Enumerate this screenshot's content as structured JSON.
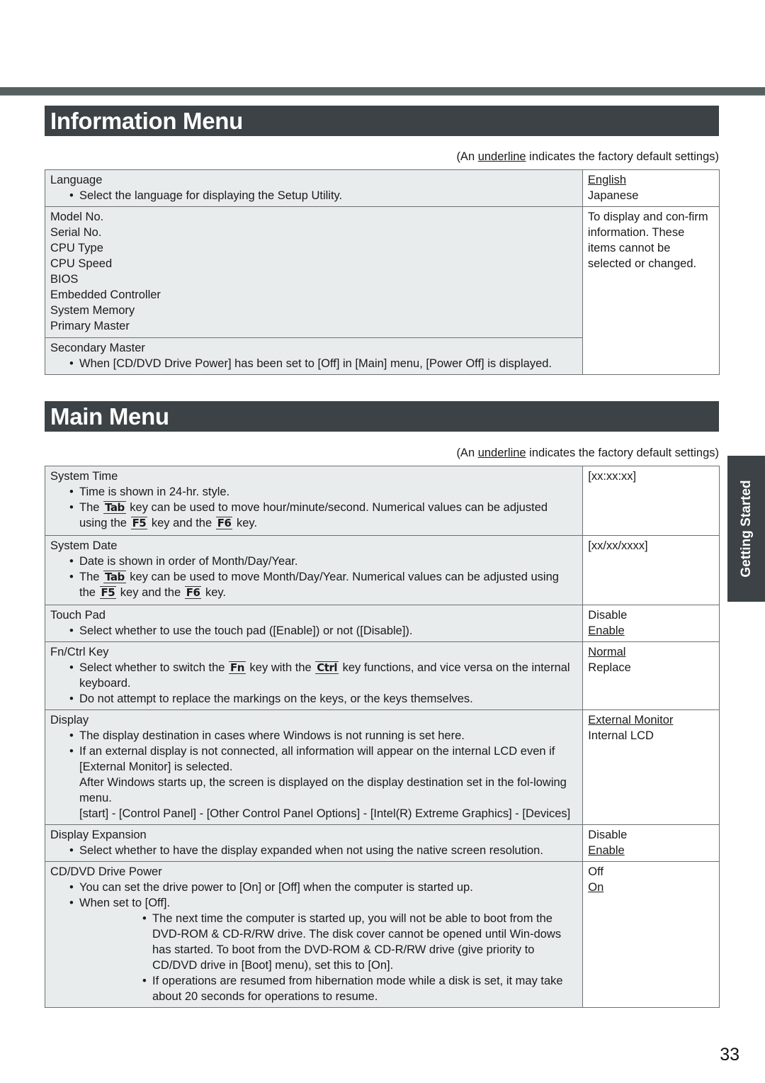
{
  "page": {
    "number": "33",
    "side_tab": "Getting Started"
  },
  "note": {
    "prefix": "(An ",
    "underline_word": "underline",
    "suffix": " indicates the factory default settings)"
  },
  "information_menu": {
    "title": "Information Menu",
    "rows": [
      {
        "label": "Language",
        "bullets": [
          "Select the language for displaying the Setup Utility."
        ],
        "options": [
          {
            "text": "English",
            "default": true
          },
          {
            "text": "Japanese",
            "default": false
          }
        ]
      }
    ],
    "info_items": [
      "Model No.",
      "Serial No.",
      "CPU Type",
      "CPU Speed",
      "BIOS",
      "Embedded Controller",
      "System Memory",
      "Primary Master"
    ],
    "info_note": "To display and con-firm information. These items cannot be selected or changed.",
    "secondary": {
      "label": "Secondary Master",
      "bullet": "When [CD/DVD Drive Power] has been set to [Off] in [Main] menu, [Power Off] is displayed."
    }
  },
  "main_menu": {
    "title": "Main Menu",
    "keys": {
      "tab": "Tab",
      "f5": "F5",
      "f6": "F6",
      "fn": "Fn",
      "ctrl": "Ctrl"
    },
    "system_time": {
      "label": "System Time",
      "b1": "Time is shown in 24-hr. style.",
      "b2_a": "The ",
      "b2_b": " key can be used to move hour/minute/second. Numerical values can be adjusted using the ",
      "b2_c": " key and the ",
      "b2_d": " key.",
      "value": "[xx:xx:xx]"
    },
    "system_date": {
      "label": "System Date",
      "b1": "Date is shown in order of Month/Day/Year.",
      "b2_a": "The ",
      "b2_b": " key can be used to move Month/Day/Year. Numerical values can be adjusted using the ",
      "b2_c": " key and the ",
      "b2_d": " key.",
      "value": "[xx/xx/xxxx]"
    },
    "touch_pad": {
      "label": "Touch Pad",
      "b1": "Select whether to use the touch pad ([Enable]) or not ([Disable]).",
      "options": [
        {
          "text": "Disable",
          "default": false
        },
        {
          "text": "Enable",
          "default": true
        }
      ]
    },
    "fn_ctrl": {
      "label": "Fn/Ctrl Key",
      "b1_a": "Select whether to switch the ",
      "b1_b": " key with the ",
      "b1_c": " key functions, and vice versa on the internal keyboard.",
      "b2": "Do not attempt to replace the markings on the keys, or the keys themselves.",
      "options": [
        {
          "text": "Normal",
          "default": true
        },
        {
          "text": "Replace",
          "default": false
        }
      ]
    },
    "display": {
      "label": "Display",
      "b1": "The display destination in cases where Windows is not running is set here.",
      "b2": "If an external display is not connected, all information will appear on the internal LCD even if [External Monitor] is selected.",
      "b2_cont": "After Windows starts up, the screen is displayed on the display destination set in the fol-lowing menu.",
      "b2_path": "[start] - [Control Panel] - [Other Control Panel Options] - [Intel(R) Extreme Graphics] - [Devices]",
      "options": [
        {
          "text": "External Monitor",
          "default": true
        },
        {
          "text": "Internal LCD",
          "default": false
        }
      ]
    },
    "display_expansion": {
      "label": "Display Expansion",
      "b1": "Select whether to have the display expanded when not using the native screen resolution.",
      "options": [
        {
          "text": "Disable",
          "default": false
        },
        {
          "text": "Enable",
          "default": true
        }
      ]
    },
    "cd_dvd_power": {
      "label": "CD/DVD Drive Power",
      "b1": "You can set the drive power to [On] or [Off] when the computer is started up.",
      "b2": "When set to [Off].",
      "sub1": "The next time the computer is started up, you will not be able to boot from the DVD-ROM & CD-R/RW drive. The disk cover cannot be opened until Win-dows has started. To boot from the DVD-ROM & CD-R/RW drive (give priority to CD/DVD drive in [Boot] menu), set this to [On].",
      "sub2": "If operations are resumed from hibernation mode while a disk is set, it may take about 20 seconds for operations to resume.",
      "options": [
        {
          "text": "Off",
          "default": false
        },
        {
          "text": "On",
          "default": true
        }
      ]
    }
  }
}
